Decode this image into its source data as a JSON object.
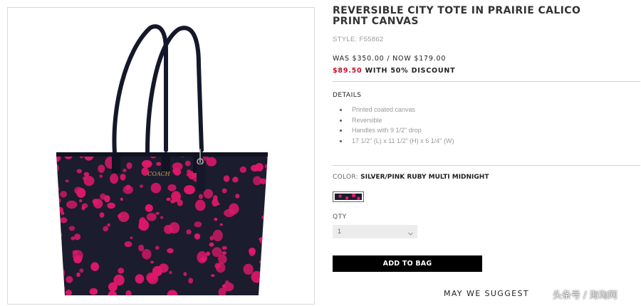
{
  "product": {
    "title": "REVERSIBLE CITY TOTE IN PRAIRIE CALICO PRINT CANVAS",
    "style": "STYLE: F55862",
    "price_line": "WAS $350.00 / NOW $179.00",
    "discount_price": "$89.50",
    "discount_text": " WITH 50% DISCOUNT",
    "logo_text": "COACH"
  },
  "details": {
    "heading": "DETAILS",
    "items": [
      "Printed coated canvas",
      "Reversible",
      "Handles with 9 1/2\" drop",
      "17 1/2\" (L) x 11 1/2\" (H) x 6 1/4\" (W)"
    ]
  },
  "color": {
    "label": "COLOR: ",
    "value": "SILVER/PINK RUBY MULTI MIDNIGHT",
    "swatch_colors": [
      "#1b1c2e",
      "#e0186a"
    ]
  },
  "quantity": {
    "label": "QTY",
    "selected": "1"
  },
  "actions": {
    "add_to_bag": "ADD TO BAG"
  },
  "suggest": {
    "heading": "MAY WE SUGGEST"
  },
  "watermark": {
    "text": "头条号 / 海淘网"
  }
}
